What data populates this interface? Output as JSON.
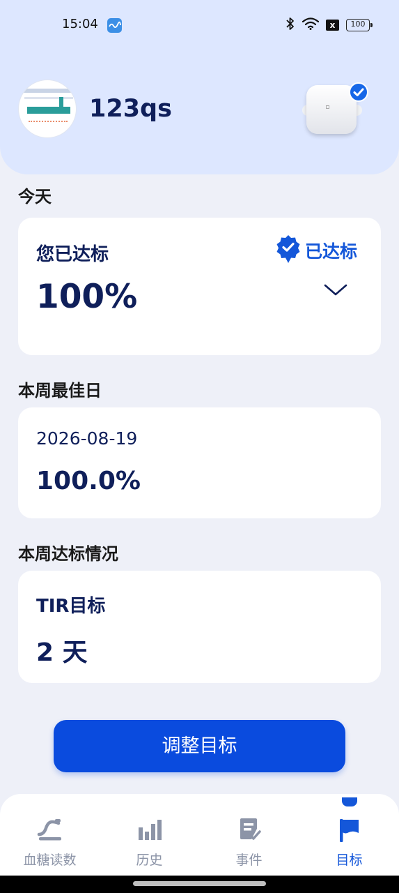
{
  "status_bar": {
    "time": "15:04",
    "battery": "100",
    "x_badge": "x",
    "icons": [
      "app-icon",
      "bluetooth-icon",
      "wifi-icon",
      "x-badge-icon",
      "battery-icon"
    ]
  },
  "header": {
    "username": "123qs",
    "device_status_icon": "check-circle-icon"
  },
  "today": {
    "section_title": "今天",
    "label": "您已达标",
    "value": "100%",
    "badge": "已达标"
  },
  "best_day": {
    "section_title": "本周最佳日",
    "date": "2026-08-19",
    "value": "100.0%"
  },
  "weekly": {
    "section_title": "本周达标情况",
    "label": "TIR目标",
    "value": "2 天"
  },
  "actions": {
    "adjust_goal": "调整目标"
  },
  "nav": {
    "items": [
      {
        "label": "血糖读数",
        "icon": "glucose-curve-icon"
      },
      {
        "label": "历史",
        "icon": "bar-chart-icon"
      },
      {
        "label": "事件",
        "icon": "event-note-icon"
      },
      {
        "label": "目标",
        "icon": "flag-icon"
      }
    ],
    "active_index": 3
  },
  "colors": {
    "accent": "#1457d9",
    "button": "#0a4bde",
    "header_bg": "#dde7ff",
    "page_bg": "#eef0f8",
    "text_dark": "#0f1f5a",
    "nav_inactive": "#8c94a7"
  }
}
